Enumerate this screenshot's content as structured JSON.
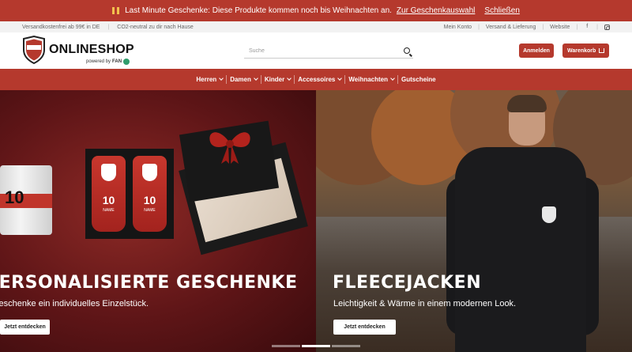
{
  "promo": {
    "text": "Last Minute Geschenke: Diese Produkte kommen noch bis Weihnachten an.",
    "link": "Zur Geschenkauswahl",
    "close": "Schließen"
  },
  "infobar": {
    "left": [
      "Versandkostenfrei ab 99€ in DE",
      "CO2-neutral zu dir nach Hause"
    ],
    "right": [
      "Mein Konto",
      "Versand & Lieferung",
      "Website"
    ],
    "social": [
      "facebook-icon",
      "instagram-icon"
    ]
  },
  "header": {
    "logo_title": "ONLINESHOP",
    "powered_by": "powered by",
    "powered_brand": "FAN",
    "search_placeholder": "Suche",
    "login": "Anmelden",
    "cart": "Warenkorb"
  },
  "nav": {
    "items": [
      {
        "label": "Herren",
        "dropdown": true
      },
      {
        "label": "Damen",
        "dropdown": true
      },
      {
        "label": "Kinder",
        "dropdown": true
      },
      {
        "label": "Accessoires",
        "dropdown": true
      },
      {
        "label": "Weihnachten",
        "dropdown": true
      },
      {
        "label": "Gutscheine",
        "dropdown": false
      }
    ]
  },
  "hero": {
    "slides": [
      {
        "title": "PERSONALISIERTE GESCHENKE",
        "subtitle": "Geschenke ein individuelles Einzelstück.",
        "button": "Jetzt entdecken",
        "mug_number": "10",
        "guard_number": "10",
        "guard_name": "NAME"
      },
      {
        "title": "FLEECEJACKEN",
        "subtitle": "Leichtigkeit & Wärme in einem modernen Look.",
        "button": "Jetzt entdecken"
      }
    ],
    "pager": {
      "count": 3,
      "active": 1
    }
  },
  "colors": {
    "brand_red": "#b5392d",
    "white": "#ffffff"
  }
}
